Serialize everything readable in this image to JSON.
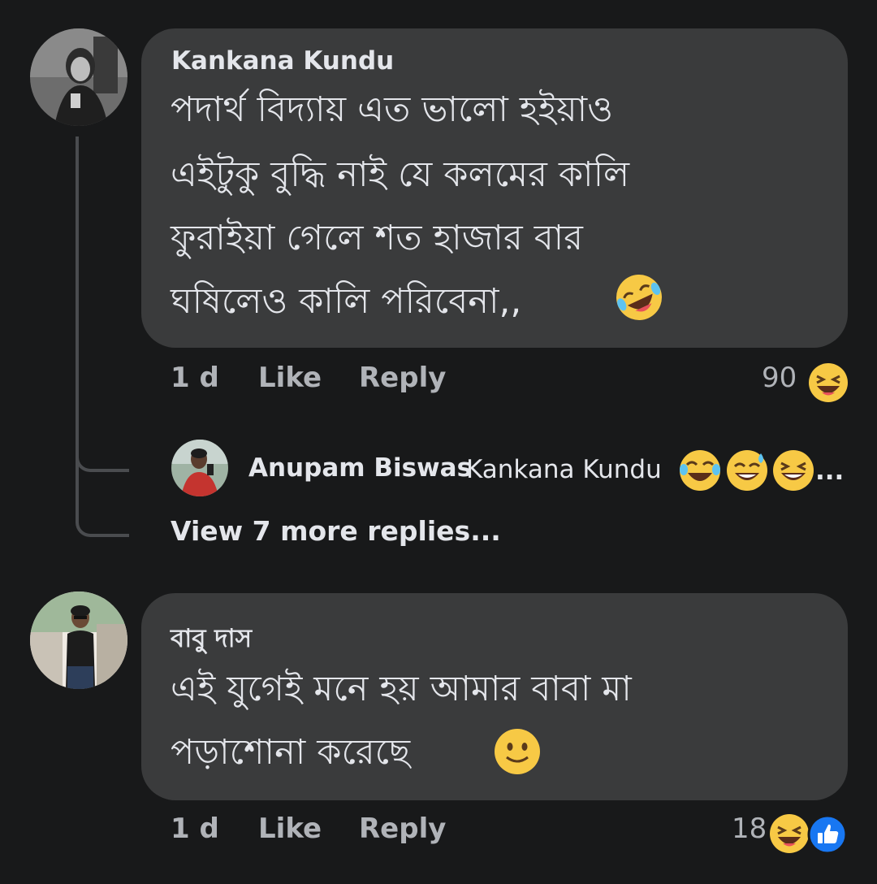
{
  "comments": [
    {
      "author": "Kankana Kundu",
      "lines": [
        "পদার্থ বিদ্যায় এত ভালো হইয়াও",
        "এইটুকু বুদ্ধি নাই যে কলমের কালি",
        "ফুরাইয়া গেলে শত হাজার বার",
        "ঘষিলেও কালি পরিবেনা,,"
      ],
      "trailing_emoji": "rofl-emoji",
      "time": "1 d",
      "like_label": "Like",
      "reply_label": "Reply",
      "reaction_count": "90",
      "reaction_icons": [
        "haha-reaction-icon"
      ]
    },
    {
      "author": "বাবু দাস",
      "lines": [
        "এই যুগেই মনে হয় আমার বাবা মা",
        "পড়াশোনা করেছে"
      ],
      "trailing_emoji": "slight-smile-emoji",
      "time": "1 d",
      "like_label": "Like",
      "reply_label": "Reply",
      "reaction_count": "18",
      "reaction_icons": [
        "haha-reaction-icon",
        "like-reaction-icon"
      ]
    }
  ],
  "reply_preview": {
    "author": "Anupam Biswas",
    "mention": "Kankana Kundu",
    "emojis": [
      "joy-emoji",
      "sweat-smile-emoji",
      "laughing-emoji"
    ],
    "ellipsis": "..."
  },
  "view_more": "View 7 more replies...",
  "colors": {
    "background": "#18191a",
    "bubble": "#3a3b3c",
    "text": "#e4e6eb",
    "secondary_text": "#b0b3b8",
    "emoji_yellow": "#f7c945",
    "like_blue": "#1877f2"
  }
}
